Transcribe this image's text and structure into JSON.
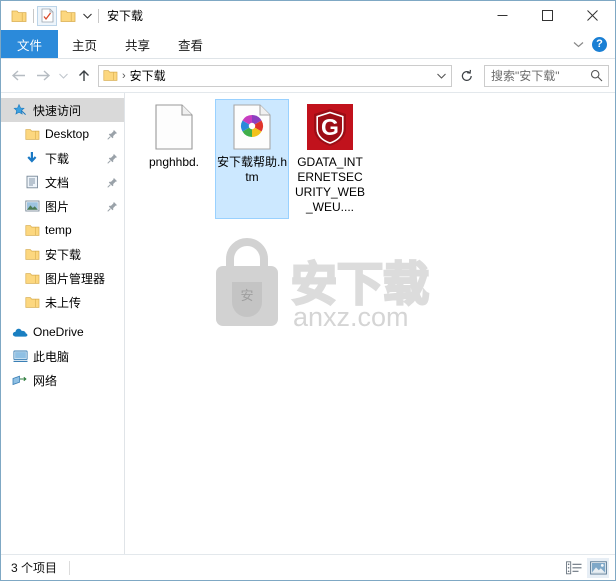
{
  "window": {
    "title": "安下载",
    "quick_access": [
      {
        "name": "folder-icon",
        "label": "folder"
      },
      {
        "name": "properties-icon",
        "label": "properties"
      },
      {
        "name": "new-folder-icon",
        "label": "new folder"
      }
    ],
    "controls": {
      "minimize": "─",
      "maximize": "□",
      "close": "✕"
    }
  },
  "ribbon": {
    "tabs": [
      {
        "label": "文件",
        "active": true
      },
      {
        "label": "主页",
        "active": false
      },
      {
        "label": "共享",
        "active": false
      },
      {
        "label": "查看",
        "active": false
      }
    ],
    "expand_icon": "chevron-down-icon",
    "help_label": "?"
  },
  "address": {
    "back_icon": "←",
    "forward_icon": "→",
    "history_icon": "⌄",
    "up_icon": "↑",
    "separator": "›",
    "crumb": "安下载",
    "dropdown_icon": "⌄",
    "refresh_icon": "↻"
  },
  "search": {
    "placeholder": "搜索\"安下载\"",
    "icon": "search-icon"
  },
  "sidebar": {
    "items": [
      {
        "label": "快速访问",
        "icon": "star-pin-icon",
        "indent": 0,
        "selected": true,
        "pinned": false
      },
      {
        "label": "Desktop",
        "icon": "folder-icon",
        "indent": 1,
        "selected": false,
        "pinned": true
      },
      {
        "label": "下载",
        "icon": "download-arrow-icon",
        "indent": 1,
        "selected": false,
        "pinned": true
      },
      {
        "label": "文档",
        "icon": "documents-icon",
        "indent": 1,
        "selected": false,
        "pinned": true
      },
      {
        "label": "图片",
        "icon": "pictures-icon",
        "indent": 1,
        "selected": false,
        "pinned": true
      },
      {
        "label": "temp",
        "icon": "folder-icon",
        "indent": 1,
        "selected": false,
        "pinned": false
      },
      {
        "label": "安下载",
        "icon": "folder-icon",
        "indent": 1,
        "selected": false,
        "pinned": false
      },
      {
        "label": "图片管理器",
        "icon": "folder-icon",
        "indent": 1,
        "selected": false,
        "pinned": false
      },
      {
        "label": "未上传",
        "icon": "folder-icon",
        "indent": 1,
        "selected": false,
        "pinned": false
      },
      {
        "label": "OneDrive",
        "icon": "onedrive-cloud-icon",
        "indent": 0,
        "selected": false,
        "pinned": false
      },
      {
        "label": "此电脑",
        "icon": "this-pc-icon",
        "indent": 0,
        "selected": false,
        "pinned": false
      },
      {
        "label": "网络",
        "icon": "network-icon",
        "indent": 0,
        "selected": false,
        "pinned": false
      }
    ]
  },
  "files": [
    {
      "name": "pnghhbd.",
      "icon": "blank-document-icon",
      "selected": false
    },
    {
      "name": "安下载帮助.htm",
      "icon": "pinwheel-html-icon",
      "selected": true
    },
    {
      "name": "GDATA_INTERNETSECURITY_WEB_WEU....",
      "icon": "gdata-shield-icon",
      "selected": false
    }
  ],
  "watermark": {
    "text": "安下载",
    "domain": "anxz.com",
    "badge": "安"
  },
  "statusbar": {
    "item_count": "3 个项目",
    "views": [
      {
        "icon": "details-view-icon",
        "active": false
      },
      {
        "icon": "large-icons-view-icon",
        "active": true
      }
    ]
  },
  "colors": {
    "accent_blue": "#2b8ada",
    "selection_blue": "#cce8ff",
    "folder_yellow": "#fcd77f",
    "gdata_red": "#c1121c"
  }
}
